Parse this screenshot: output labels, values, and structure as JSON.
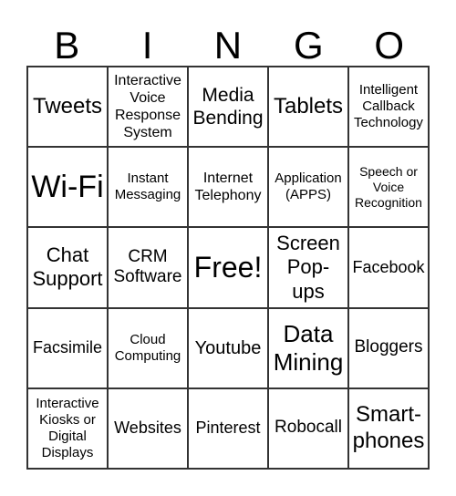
{
  "header": [
    "B",
    "I",
    "N",
    "G",
    "O"
  ],
  "cells": [
    {
      "text": "Tweets",
      "size": 24
    },
    {
      "text": "Interactive\nVoice\nResponse\nSystem",
      "size": 16
    },
    {
      "text": "Media\nBending",
      "size": 21
    },
    {
      "text": "Tablets",
      "size": 24
    },
    {
      "text": "Intelligent\nCallback\nTechnology",
      "size": 15
    },
    {
      "text": "Wi-Fi",
      "size": 34
    },
    {
      "text": "Instant\nMessaging",
      "size": 15
    },
    {
      "text": "Internet\nTelephony",
      "size": 16
    },
    {
      "text": "Application\n(APPS)",
      "size": 15
    },
    {
      "text": "Speech or\nVoice\nRecognition",
      "size": 14
    },
    {
      "text": "Chat\nSupport",
      "size": 22
    },
    {
      "text": "CRM\nSoftware",
      "size": 19
    },
    {
      "text": "Free!",
      "size": 32
    },
    {
      "text": "Screen\nPop-\nups",
      "size": 22
    },
    {
      "text": "Facebook",
      "size": 18
    },
    {
      "text": "Facsimile",
      "size": 18
    },
    {
      "text": "Cloud\nComputing",
      "size": 15
    },
    {
      "text": "Youtube",
      "size": 20
    },
    {
      "text": "Data\nMining",
      "size": 26
    },
    {
      "text": "Bloggers",
      "size": 19
    },
    {
      "text": "Interactive\nKiosks or\nDigital\nDisplays",
      "size": 15
    },
    {
      "text": "Websites",
      "size": 18
    },
    {
      "text": "Pinterest",
      "size": 18
    },
    {
      "text": "Robocall",
      "size": 19
    },
    {
      "text": "Smart-\nphones",
      "size": 24
    }
  ]
}
